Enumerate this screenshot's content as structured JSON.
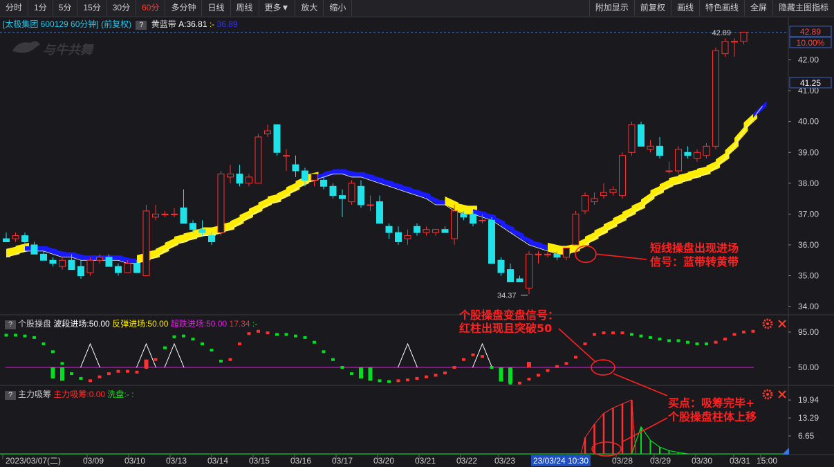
{
  "toolbar": {
    "left": [
      "分时",
      "1分",
      "5分",
      "15分",
      "30分",
      "60分",
      "多分钟",
      "日线",
      "周线",
      "更多▼",
      "放大",
      "缩小"
    ],
    "active": "60分",
    "right": [
      "附加显示",
      "前复权",
      "画线",
      "特色画线",
      "全屏",
      "隐藏主图指标"
    ]
  },
  "main_pane": {
    "stock_label": "[太极集团 600129 60分钟]",
    "adjust_label": "(前复权)",
    "indicator_name": "黄蓝带",
    "indicator_value_a": "A:36.81",
    "indicator_value_b": ":-",
    "indicator_value_c": "36.89",
    "watermark": "与牛共舞",
    "high_label": "42.89",
    "low_label": "34.37",
    "right_tags": [
      "42.89",
      "10.00%",
      "41.25"
    ],
    "price_axis": [
      "42.00",
      "41.00",
      "40.00",
      "39.00",
      "38.00",
      "37.00",
      "36.00",
      "35.00",
      "34.00"
    ],
    "annotation": [
      "短线操盘出现进场",
      "信号：蓝带转黄带"
    ]
  },
  "pane2": {
    "name": "个股操盘",
    "wave_label": "波段进场:50.00",
    "rebound_label": "反弹进场:50.00",
    "oversold_label": "超跌进场:50.00",
    "value": "17.34",
    "tail": ":-",
    "axis": [
      "95.00",
      "50.00"
    ],
    "annotation": [
      "个股操盘变盘信号：",
      "红柱出现且突破50"
    ]
  },
  "pane3": {
    "name": "主力吸筹",
    "absorb_label": "主力吸筹:0.00",
    "wash_label": "洗盘:-",
    "tail": ":",
    "axis": [
      "19.94",
      "13.29",
      "6.65"
    ],
    "annotation": [
      "买点：吸筹完毕+",
      "个股操盘柱体上移"
    ]
  },
  "date_axis": {
    "labels": [
      "2023/03/07(二)",
      "03/09",
      "03/10",
      "03/13",
      "03/14",
      "03/15",
      "03/16",
      "03/17",
      "03/20",
      "03/21",
      "03/22",
      "03/23",
      "03/28",
      "03/29",
      "03/30",
      "03/31",
      "15:00"
    ],
    "cursor": "23/03/24 10:30"
  },
  "colors": {
    "up": "#ff3030",
    "down": "#20e0e8",
    "yellow_band": "#ffee00",
    "blue_band": "#1a1aff",
    "green": "#00e020",
    "magenta": "#e020e0",
    "annotation": "#ff2020"
  },
  "chart_data": {
    "type": "candlestick",
    "timeframe": "60分钟",
    "ylim": [
      33.8,
      43.0
    ],
    "candles": [
      {
        "o": 36.2,
        "h": 36.4,
        "l": 36.1,
        "c": 36.1
      },
      {
        "o": 36.2,
        "h": 36.4,
        "l": 36.1,
        "c": 36.3
      },
      {
        "o": 36.3,
        "h": 36.4,
        "l": 36.0,
        "c": 36.1
      },
      {
        "o": 36.0,
        "h": 36.1,
        "l": 35.7,
        "c": 35.7
      },
      {
        "o": 35.7,
        "h": 35.8,
        "l": 35.5,
        "c": 35.5
      },
      {
        "o": 35.5,
        "h": 35.6,
        "l": 35.3,
        "c": 35.4
      },
      {
        "o": 35.3,
        "h": 35.6,
        "l": 35.2,
        "c": 35.5
      },
      {
        "o": 35.5,
        "h": 35.7,
        "l": 35.2,
        "c": 35.2
      },
      {
        "o": 35.3,
        "h": 35.5,
        "l": 34.9,
        "c": 35.0
      },
      {
        "o": 35.1,
        "h": 35.6,
        "l": 35.0,
        "c": 35.5
      },
      {
        "o": 35.5,
        "h": 35.7,
        "l": 35.4,
        "c": 35.6
      },
      {
        "o": 35.6,
        "h": 35.7,
        "l": 35.3,
        "c": 35.3
      },
      {
        "o": 35.3,
        "h": 35.4,
        "l": 35.0,
        "c": 35.1
      },
      {
        "o": 35.1,
        "h": 35.5,
        "l": 35.1,
        "c": 35.4
      },
      {
        "o": 35.4,
        "h": 35.5,
        "l": 35.1,
        "c": 35.1
      },
      {
        "o": 35.0,
        "h": 37.3,
        "l": 35.0,
        "c": 37.1
      },
      {
        "o": 36.9,
        "h": 37.3,
        "l": 36.8,
        "c": 37.0
      },
      {
        "o": 37.0,
        "h": 37.1,
        "l": 36.9,
        "c": 37.0
      },
      {
        "o": 37.0,
        "h": 37.2,
        "l": 36.9,
        "c": 37.0
      },
      {
        "o": 37.2,
        "h": 37.8,
        "l": 36.7,
        "c": 36.7
      },
      {
        "o": 36.7,
        "h": 36.8,
        "l": 36.4,
        "c": 36.5
      },
      {
        "o": 36.5,
        "h": 36.8,
        "l": 36.3,
        "c": 36.4
      },
      {
        "o": 36.3,
        "h": 36.4,
        "l": 36.0,
        "c": 36.1
      },
      {
        "o": 36.4,
        "h": 38.4,
        "l": 36.3,
        "c": 38.3
      },
      {
        "o": 38.2,
        "h": 38.6,
        "l": 38.0,
        "c": 38.3
      },
      {
        "o": 38.3,
        "h": 38.6,
        "l": 37.9,
        "c": 38.0
      },
      {
        "o": 38.0,
        "h": 38.3,
        "l": 37.9,
        "c": 38.2
      },
      {
        "o": 38.0,
        "h": 39.6,
        "l": 38.0,
        "c": 39.5
      },
      {
        "o": 39.6,
        "h": 39.9,
        "l": 39.5,
        "c": 39.7
      },
      {
        "o": 39.9,
        "h": 39.9,
        "l": 38.9,
        "c": 39.0
      },
      {
        "o": 38.9,
        "h": 39.1,
        "l": 38.4,
        "c": 38.9
      },
      {
        "o": 38.6,
        "h": 38.9,
        "l": 38.2,
        "c": 38.4
      },
      {
        "o": 38.4,
        "h": 38.5,
        "l": 37.9,
        "c": 38.1
      },
      {
        "o": 38.1,
        "h": 38.3,
        "l": 37.9,
        "c": 38.3
      },
      {
        "o": 38.1,
        "h": 38.2,
        "l": 37.8,
        "c": 37.9
      },
      {
        "o": 37.9,
        "h": 38.0,
        "l": 37.5,
        "c": 37.6
      },
      {
        "o": 37.6,
        "h": 37.8,
        "l": 36.9,
        "c": 37.5
      },
      {
        "o": 37.4,
        "h": 38.1,
        "l": 37.3,
        "c": 38.0
      },
      {
        "o": 37.9,
        "h": 38.1,
        "l": 37.2,
        "c": 37.3
      },
      {
        "o": 37.3,
        "h": 37.6,
        "l": 37.1,
        "c": 37.3
      },
      {
        "o": 37.4,
        "h": 37.6,
        "l": 36.7,
        "c": 36.7
      },
      {
        "o": 36.6,
        "h": 36.7,
        "l": 36.2,
        "c": 36.4
      },
      {
        "o": 36.4,
        "h": 36.6,
        "l": 36.0,
        "c": 36.1
      },
      {
        "o": 36.2,
        "h": 36.5,
        "l": 36.0,
        "c": 36.3
      },
      {
        "o": 36.6,
        "h": 36.7,
        "l": 36.3,
        "c": 36.4
      },
      {
        "o": 36.4,
        "h": 36.6,
        "l": 36.3,
        "c": 36.5
      },
      {
        "o": 36.4,
        "h": 36.5,
        "l": 36.3,
        "c": 36.5
      },
      {
        "o": 36.5,
        "h": 36.6,
        "l": 36.4,
        "c": 36.4
      },
      {
        "o": 36.2,
        "h": 37.3,
        "l": 36.0,
        "c": 37.1
      },
      {
        "o": 37.0,
        "h": 37.1,
        "l": 36.8,
        "c": 36.9
      },
      {
        "o": 37.0,
        "h": 37.1,
        "l": 36.6,
        "c": 36.7
      },
      {
        "o": 36.8,
        "h": 37.0,
        "l": 36.7,
        "c": 36.8
      },
      {
        "o": 36.8,
        "h": 36.9,
        "l": 35.4,
        "c": 35.4
      },
      {
        "o": 35.5,
        "h": 35.6,
        "l": 35.0,
        "c": 35.1
      },
      {
        "o": 35.2,
        "h": 35.4,
        "l": 34.8,
        "c": 34.8
      },
      {
        "o": 34.9,
        "h": 35.0,
        "l": 34.8,
        "c": 34.8
      },
      {
        "o": 34.6,
        "h": 35.8,
        "l": 34.4,
        "c": 35.7
      },
      {
        "o": 35.7,
        "h": 35.8,
        "l": 35.4,
        "c": 35.7
      },
      {
        "o": 35.7,
        "h": 35.8,
        "l": 35.6,
        "c": 35.7
      },
      {
        "o": 35.7,
        "h": 35.8,
        "l": 35.5,
        "c": 35.6
      },
      {
        "o": 35.6,
        "h": 35.9,
        "l": 35.5,
        "c": 35.9
      },
      {
        "o": 36.0,
        "h": 37.1,
        "l": 36.0,
        "c": 37.0
      },
      {
        "o": 37.1,
        "h": 37.7,
        "l": 37.0,
        "c": 37.6
      },
      {
        "o": 37.4,
        "h": 37.7,
        "l": 37.3,
        "c": 37.5
      },
      {
        "o": 37.6,
        "h": 38.0,
        "l": 37.5,
        "c": 37.7
      },
      {
        "o": 37.7,
        "h": 37.9,
        "l": 37.6,
        "c": 37.8
      },
      {
        "o": 37.6,
        "h": 39.0,
        "l": 37.5,
        "c": 38.9
      },
      {
        "o": 39.0,
        "h": 40.0,
        "l": 38.9,
        "c": 39.9
      },
      {
        "o": 39.9,
        "h": 40.0,
        "l": 39.2,
        "c": 39.2
      },
      {
        "o": 39.1,
        "h": 39.4,
        "l": 39.0,
        "c": 39.2
      },
      {
        "o": 39.2,
        "h": 39.5,
        "l": 38.8,
        "c": 38.9
      },
      {
        "o": 38.4,
        "h": 38.7,
        "l": 38.3,
        "c": 38.4
      },
      {
        "o": 38.4,
        "h": 39.2,
        "l": 38.3,
        "c": 39.1
      },
      {
        "o": 39.0,
        "h": 39.2,
        "l": 38.8,
        "c": 38.9
      },
      {
        "o": 38.8,
        "h": 39.1,
        "l": 38.7,
        "c": 39.0
      },
      {
        "o": 38.9,
        "h": 39.3,
        "l": 38.8,
        "c": 39.2
      },
      {
        "o": 39.2,
        "h": 42.4,
        "l": 39.1,
        "c": 42.3
      },
      {
        "o": 42.2,
        "h": 42.7,
        "l": 42.1,
        "c": 42.6
      },
      {
        "o": 42.6,
        "h": 42.7,
        "l": 42.1,
        "c": 42.6
      },
      {
        "o": 42.6,
        "h": 42.9,
        "l": 42.5,
        "c": 42.9
      }
    ],
    "band_support": [
      35.6,
      35.7,
      35.8,
      35.8,
      35.8,
      35.7,
      35.6,
      35.6,
      35.5,
      35.5,
      35.5,
      35.5,
      35.5,
      35.4,
      35.4,
      35.5,
      35.6,
      35.8,
      36.0,
      36.1,
      36.2,
      36.3,
      36.3,
      36.4,
      36.5,
      36.7,
      36.9,
      37.1,
      37.3,
      37.4,
      37.6,
      37.8,
      38.0,
      38.1,
      38.2,
      38.3,
      38.3,
      38.2,
      38.2,
      38.1,
      38.0,
      37.9,
      37.8,
      37.7,
      37.6,
      37.5,
      37.3,
      37.3,
      37.1,
      37.0,
      37.0,
      36.9,
      36.8,
      36.6,
      36.4,
      36.2,
      36.0,
      35.9,
      35.8,
      35.7,
      35.7,
      35.8,
      36.0,
      36.2,
      36.4,
      36.6,
      36.8,
      37.0,
      37.2,
      37.5,
      37.7,
      37.9,
      38.0,
      38.1,
      38.2,
      38.3,
      38.5,
      38.8,
      39.2,
      39.7,
      40.1,
      40.5
    ],
    "band_color": [
      "yellow",
      "yellow",
      "yellow",
      "blue",
      "blue",
      "blue",
      "blue",
      "blue",
      "blue",
      "blue",
      "blue",
      "blue",
      "blue",
      "blue",
      "blue",
      "yellow",
      "yellow",
      "yellow",
      "yellow",
      "yellow",
      "yellow",
      "yellow",
      "yellow",
      "yellow",
      "yellow",
      "yellow",
      "yellow",
      "yellow",
      "yellow",
      "yellow",
      "yellow",
      "yellow",
      "yellow",
      "yellow",
      "blue",
      "blue",
      "blue",
      "blue",
      "blue",
      "blue",
      "blue",
      "blue",
      "blue",
      "blue",
      "blue",
      "blue",
      "blue",
      "blue",
      "yellow",
      "yellow",
      "yellow",
      "blue",
      "blue",
      "blue",
      "blue",
      "blue",
      "blue",
      "blue",
      "blue",
      "yellow",
      "yellow",
      "yellow",
      "yellow",
      "yellow",
      "yellow",
      "yellow",
      "yellow",
      "yellow",
      "yellow",
      "yellow",
      "yellow",
      "yellow",
      "yellow",
      "yellow",
      "yellow",
      "yellow",
      "yellow",
      "yellow",
      "yellow",
      "yellow",
      "yellow"
    ],
    "pane2_ylim": [
      28,
      102
    ],
    "pane2_dots": [
      {
        "v": 91,
        "c": "green"
      },
      {
        "v": 91,
        "c": "green"
      },
      {
        "v": 90,
        "c": "green"
      },
      {
        "v": 88,
        "c": "green"
      },
      {
        "v": 80,
        "c": "green"
      },
      {
        "v": 70,
        "c": "green"
      },
      {
        "v": 55,
        "c": "green"
      },
      {
        "v": 42,
        "c": "green"
      },
      {
        "v": 36,
        "c": "green"
      },
      {
        "v": 33,
        "c": "red"
      },
      {
        "v": 38,
        "c": "red"
      },
      {
        "v": 42,
        "c": "red"
      },
      {
        "v": 45,
        "c": "red"
      },
      {
        "v": 45,
        "c": "red"
      },
      {
        "v": 44,
        "c": "red"
      },
      {
        "v": 50,
        "c": "red"
      },
      {
        "v": 60,
        "c": "red"
      },
      {
        "v": 75,
        "c": "green"
      },
      {
        "v": 89,
        "c": "green"
      },
      {
        "v": 90,
        "c": "green"
      },
      {
        "v": 86,
        "c": "green"
      },
      {
        "v": 80,
        "c": "green"
      },
      {
        "v": 72,
        "c": "green"
      },
      {
        "v": 58,
        "c": "green"
      },
      {
        "v": 60,
        "c": "red"
      },
      {
        "v": 80,
        "c": "red"
      },
      {
        "v": 93,
        "c": "red"
      },
      {
        "v": 96,
        "c": "red"
      },
      {
        "v": 94,
        "c": "red"
      },
      {
        "v": 92,
        "c": "green"
      },
      {
        "v": 92,
        "c": "green"
      },
      {
        "v": 90,
        "c": "green"
      },
      {
        "v": 88,
        "c": "green"
      },
      {
        "v": 82,
        "c": "green"
      },
      {
        "v": 70,
        "c": "green"
      },
      {
        "v": 60,
        "c": "green"
      },
      {
        "v": 50,
        "c": "green"
      },
      {
        "v": 42,
        "c": "green"
      },
      {
        "v": 38,
        "c": "green"
      },
      {
        "v": 36,
        "c": "green"
      },
      {
        "v": 33,
        "c": "green"
      },
      {
        "v": 32,
        "c": "green"
      },
      {
        "v": 33,
        "c": "red"
      },
      {
        "v": 34,
        "c": "red"
      },
      {
        "v": 36,
        "c": "red"
      },
      {
        "v": 38,
        "c": "red"
      },
      {
        "v": 40,
        "c": "red"
      },
      {
        "v": 43,
        "c": "red"
      },
      {
        "v": 50,
        "c": "red"
      },
      {
        "v": 60,
        "c": "red"
      },
      {
        "v": 66,
        "c": "red"
      },
      {
        "v": 64,
        "c": "red"
      },
      {
        "v": 50,
        "c": "green"
      },
      {
        "v": 38,
        "c": "green"
      },
      {
        "v": 30,
        "c": "green"
      },
      {
        "v": 30,
        "c": "red"
      },
      {
        "v": 35,
        "c": "red"
      },
      {
        "v": 40,
        "c": "red"
      },
      {
        "v": 46,
        "c": "red"
      },
      {
        "v": 51,
        "c": "red"
      },
      {
        "v": 55,
        "c": "red"
      },
      {
        "v": 63,
        "c": "red"
      },
      {
        "v": 80,
        "c": "red"
      },
      {
        "v": 92,
        "c": "red"
      },
      {
        "v": 94,
        "c": "red"
      },
      {
        "v": 94,
        "c": "red"
      },
      {
        "v": 94,
        "c": "red"
      },
      {
        "v": 92,
        "c": "green"
      },
      {
        "v": 90,
        "c": "green"
      },
      {
        "v": 88,
        "c": "green"
      },
      {
        "v": 86,
        "c": "green"
      },
      {
        "v": 84,
        "c": "green"
      },
      {
        "v": 84,
        "c": "green"
      },
      {
        "v": 82,
        "c": "green"
      },
      {
        "v": 80,
        "c": "green"
      },
      {
        "v": 80,
        "c": "green"
      },
      {
        "v": 82,
        "c": "red"
      },
      {
        "v": 86,
        "c": "red"
      },
      {
        "v": 92,
        "c": "red"
      },
      {
        "v": 95,
        "c": "red"
      },
      {
        "v": 96,
        "c": "red"
      }
    ],
    "pane2_bars": [
      {
        "i": 15,
        "from": 50,
        "to": 60
      },
      {
        "i": 56,
        "from": 50,
        "to": 57
      }
    ],
    "pane2_triangles": [
      9,
      15,
      18,
      43,
      51
    ],
    "pane3_ylim": [
      0,
      21
    ],
    "pane3_red_bars": [
      {
        "i": 62,
        "v": 6
      },
      {
        "i": 63,
        "v": 11
      },
      {
        "i": 64,
        "v": 15
      },
      {
        "i": 65,
        "v": 17
      },
      {
        "i": 66,
        "v": 18.5
      },
      {
        "i": 67,
        "v": 19.94
      }
    ],
    "pane3_green_line": [
      {
        "i": 67,
        "v": 0
      },
      {
        "i": 68,
        "v": 10
      },
      {
        "i": 69,
        "v": 5
      },
      {
        "i": 70,
        "v": 2.5
      },
      {
        "i": 71,
        "v": 1.2
      },
      {
        "i": 72,
        "v": 0.5
      },
      {
        "i": 73,
        "v": 0
      }
    ]
  }
}
